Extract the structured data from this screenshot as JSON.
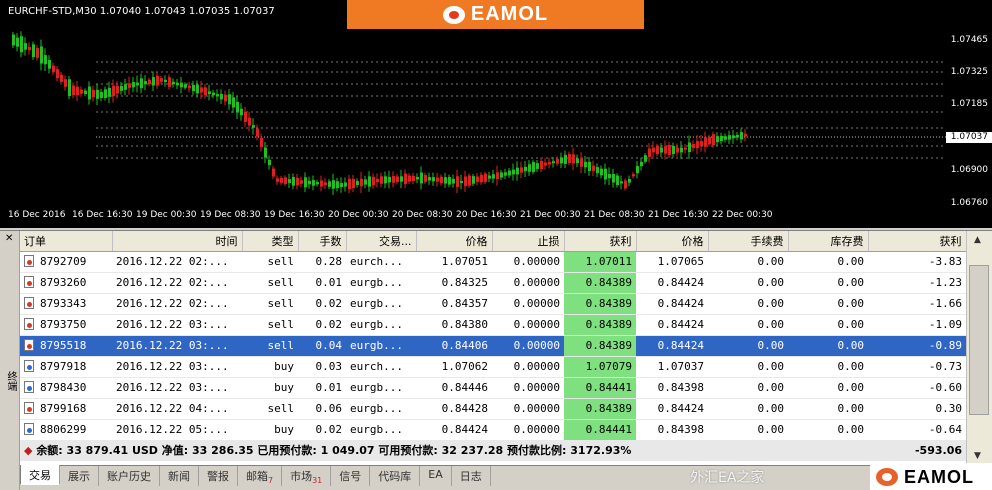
{
  "chart": {
    "symbol_line": "EURCHF-STD,M30  1.07040 1.07043 1.07035 1.07037",
    "price_ticks": [
      "1.07465",
      "1.07325",
      "1.07185",
      "1.07037",
      "1.06900",
      "1.06760"
    ],
    "current_price": "1.07037",
    "time_ticks": [
      "16 Dec 2016",
      "16 Dec 16:30",
      "19 Dec 00:30",
      "19 Dec 08:30",
      "19 Dec 16:30",
      "20 Dec 00:30",
      "20 Dec 08:30",
      "20 Dec 16:30",
      "21 Dec 00:30",
      "21 Dec 08:30",
      "21 Dec 16:30",
      "22 Dec 00:30"
    ],
    "up_color": "#e02020",
    "down_color": "#20c020"
  },
  "brand": {
    "name": "EAMOL"
  },
  "watermark": "外汇EA之家",
  "terminal": {
    "side_label": "终端",
    "columns": [
      "订单",
      "时间",
      "类型",
      "手数",
      "交易...",
      "价格",
      "止损",
      "获利",
      "价格",
      "手续费",
      "库存费",
      "获利"
    ],
    "rows": [
      {
        "order": "8792709",
        "time": "2016.12.22 02:...",
        "type": "sell",
        "lots": "0.28",
        "symbol": "eurch...",
        "price": "1.07051",
        "sl": "0.00000",
        "tp": "1.07011",
        "cur": "1.07065",
        "fee": "0.00",
        "swap": "0.00",
        "profit": "-3.83"
      },
      {
        "order": "8793260",
        "time": "2016.12.22 02:...",
        "type": "sell",
        "lots": "0.01",
        "symbol": "eurgb...",
        "price": "0.84325",
        "sl": "0.00000",
        "tp": "0.84389",
        "cur": "0.84424",
        "fee": "0.00",
        "swap": "0.00",
        "profit": "-1.23"
      },
      {
        "order": "8793343",
        "time": "2016.12.22 02:...",
        "type": "sell",
        "lots": "0.02",
        "symbol": "eurgb...",
        "price": "0.84357",
        "sl": "0.00000",
        "tp": "0.84389",
        "cur": "0.84424",
        "fee": "0.00",
        "swap": "0.00",
        "profit": "-1.66"
      },
      {
        "order": "8793750",
        "time": "2016.12.22 03:...",
        "type": "sell",
        "lots": "0.02",
        "symbol": "eurgb...",
        "price": "0.84380",
        "sl": "0.00000",
        "tp": "0.84389",
        "cur": "0.84424",
        "fee": "0.00",
        "swap": "0.00",
        "profit": "-1.09"
      },
      {
        "order": "8795518",
        "time": "2016.12.22 03:...",
        "type": "sell",
        "lots": "0.04",
        "symbol": "eurgb...",
        "price": "0.84406",
        "sl": "0.00000",
        "tp": "0.84389",
        "cur": "0.84424",
        "fee": "0.00",
        "swap": "0.00",
        "profit": "-0.89"
      },
      {
        "order": "8797918",
        "time": "2016.12.22 03:...",
        "type": "buy",
        "lots": "0.03",
        "symbol": "eurch...",
        "price": "1.07062",
        "sl": "0.00000",
        "tp": "1.07079",
        "cur": "1.07037",
        "fee": "0.00",
        "swap": "0.00",
        "profit": "-0.73"
      },
      {
        "order": "8798430",
        "time": "2016.12.22 03:...",
        "type": "buy",
        "lots": "0.01",
        "symbol": "eurgb...",
        "price": "0.84446",
        "sl": "0.00000",
        "tp": "0.84441",
        "cur": "0.84398",
        "fee": "0.00",
        "swap": "0.00",
        "profit": "-0.60"
      },
      {
        "order": "8799168",
        "time": "2016.12.22 04:...",
        "type": "sell",
        "lots": "0.06",
        "symbol": "eurgb...",
        "price": "0.84428",
        "sl": "0.00000",
        "tp": "0.84389",
        "cur": "0.84424",
        "fee": "0.00",
        "swap": "0.00",
        "profit": "0.30"
      },
      {
        "order": "8806299",
        "time": "2016.12.22 05:...",
        "type": "buy",
        "lots": "0.02",
        "symbol": "eurgb...",
        "price": "0.84424",
        "sl": "0.00000",
        "tp": "0.84441",
        "cur": "0.84398",
        "fee": "0.00",
        "swap": "0.00",
        "profit": "-0.64"
      }
    ],
    "selected_row": 4,
    "summary": "余额: 33 879.41 USD  净值: 33 286.35  已用预付款: 1 049.07  可用预付款: 32 237.28  预付款比例: 3172.93%",
    "summary_profit": "-593.06"
  },
  "tabs": [
    {
      "label": "交易",
      "badge": ""
    },
    {
      "label": "展示",
      "badge": ""
    },
    {
      "label": "账户历史",
      "badge": ""
    },
    {
      "label": "新闻",
      "badge": ""
    },
    {
      "label": "警报",
      "badge": ""
    },
    {
      "label": "邮箱",
      "badge": "7"
    },
    {
      "label": "市场",
      "badge": "31"
    },
    {
      "label": "信号",
      "badge": ""
    },
    {
      "label": "代码库",
      "badge": ""
    },
    {
      "label": "EA",
      "badge": ""
    },
    {
      "label": "日志",
      "badge": ""
    }
  ]
}
